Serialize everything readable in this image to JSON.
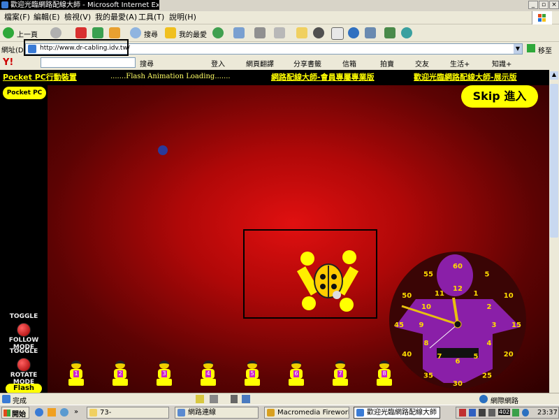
{
  "window": {
    "title": "歡迎光臨網路配線大師 - Microsoft Internet Explorer",
    "controls": {
      "minimize": "_",
      "maximize": "▫",
      "close": "×"
    }
  },
  "menubar": {
    "items": [
      "檔案(F)",
      "編輯(E)",
      "檢視(V)",
      "我的最愛(A)",
      "工具(T)",
      "說明(H)"
    ]
  },
  "toolbar": {
    "back_label": "上一頁",
    "search_label": "搜尋",
    "favorites_label": "我的最愛"
  },
  "addressbar": {
    "label": "網址(D)",
    "url": "http://www.dr-cabling.idv.tw/",
    "go_label": "移至"
  },
  "yahoobar": {
    "logo": "Y!",
    "search_label": "搜尋",
    "login_label": "登入",
    "items": [
      "網頁翻譯",
      "分享書籤",
      "信箱",
      "拍賣",
      "交友",
      "生活+",
      "知識+"
    ]
  },
  "flash": {
    "links": [
      "Pocket PC行動裝置",
      "網路配線大師-會員專屬專業版",
      "歡迎光臨網路配線大師-展示版"
    ],
    "loading_text": ".......Flash Animation Loading.......",
    "pocket_badge": "Pocket PC",
    "skip_label": "Skip 進入",
    "toggle_follow": [
      "TOGGLE",
      "FOLLOW MODE"
    ],
    "toggle_rotate": [
      "TOGGLE",
      "ROTATE MODE"
    ],
    "flash_badge": "Flash",
    "kids": [
      "1",
      "2",
      "3",
      "4",
      "5",
      "6",
      "7",
      "8"
    ],
    "clock_numbers": {
      "outer": [
        "60",
        "55",
        "50",
        "45",
        "40",
        "35",
        "30",
        "25",
        "20",
        "15",
        "10",
        "5"
      ],
      "inner": [
        "12",
        "11",
        "10",
        "9",
        "8",
        "7",
        "6",
        "5",
        "4",
        "3",
        "2",
        "1"
      ]
    },
    "clock_colors": {
      "figure": "#8a1fa8",
      "numbers": "#ffdd00"
    }
  },
  "statusbar": {
    "status_text": "完成",
    "zone_text": "網際網路"
  },
  "taskbar": {
    "start_label": "開始",
    "tasks": [
      {
        "label": "73-",
        "icon": "folder-icon"
      },
      {
        "label": "網路連線",
        "icon": "network-icon"
      },
      {
        "label": "Macromedia Fireworks M...",
        "icon": "fireworks-icon"
      },
      {
        "label": "歡迎光臨網路配線大師 ...",
        "icon": "ie-icon"
      }
    ],
    "clock": "23:37",
    "tray_badge": "402"
  }
}
